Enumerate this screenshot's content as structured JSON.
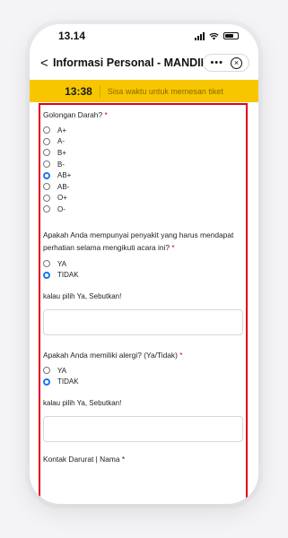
{
  "status_bar": {
    "time": "13.14"
  },
  "nav": {
    "back_glyph": "<",
    "title": "Informasi Personal - MANDIR...",
    "more_glyph": "•••",
    "close_glyph": "×"
  },
  "timer_banner": {
    "time": "13:38",
    "text": "Sisa waktu untuk memesan tiket",
    "color": "#f7c600"
  },
  "form": {
    "blood_type": {
      "label": "Golongan Darah?",
      "required_mark": "*",
      "options": [
        "A+",
        "A-",
        "B+",
        "B-",
        "AB+",
        "AB-",
        "O+",
        "O-"
      ],
      "selected": "AB+"
    },
    "illness": {
      "label": "Apakah Anda mempunyai penyakit yang harus mendapat perhatian selama mengikuti acara ini?",
      "required_mark": "*",
      "options": [
        "YA",
        "TIDAK"
      ],
      "selected": "TIDAK",
      "followup_label": "kalau pilih Ya, Sebutkan!",
      "followup_value": ""
    },
    "allergy": {
      "label": "Apakah Anda memiliki alergi? (Ya/Tidak)",
      "required_mark": "*",
      "options": [
        "YA",
        "TIDAK"
      ],
      "selected": "TIDAK",
      "followup_label": "kalau pilih Ya, Sebutkan!",
      "followup_value": ""
    },
    "emergency_contact": {
      "label": "Kontak Darurat | Nama",
      "required_mark": "*"
    }
  },
  "colors": {
    "accent_radio": "#1778f2",
    "highlight_border": "#e0001b"
  }
}
